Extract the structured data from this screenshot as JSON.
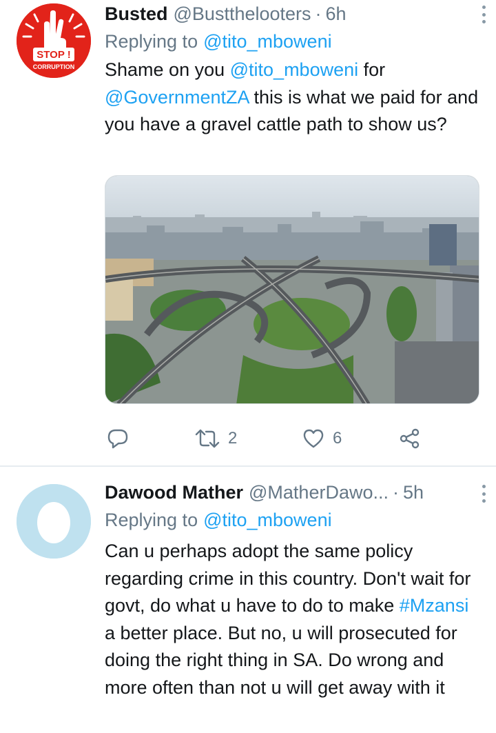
{
  "tweets": [
    {
      "name": "Busted",
      "handle": "@Bustthelooters",
      "dot": "·",
      "time": "6h",
      "replying_label": "Replying to",
      "replying_to": "@tito_mboweni",
      "text_parts": {
        "p1": "Shame on you ",
        "m1": "@tito_mboweni",
        "p2": " for ",
        "m2": "@GovernmentZA",
        "p3": " this is what we paid for and you have a gravel cattle path to show us?"
      },
      "avatar": {
        "label_top": "STOP !",
        "label_bottom": "CORRUPTION",
        "color": "#e2231a"
      },
      "media": {
        "description": "aerial city highway interchange"
      },
      "actions": {
        "reply_count": "",
        "retweet_count": "2",
        "like_count": "6"
      }
    },
    {
      "name": "Dawood Mather",
      "handle": "@MatherDawo...",
      "dot": "·",
      "time": "5h",
      "replying_label": "Replying to",
      "replying_to": "@tito_mboweni",
      "text_parts": {
        "p1": "Can u perhaps adopt the same policy regarding crime in this country. Don't wait for govt, do what u have to do to make ",
        "m1": "#Mzansi",
        "p2": " a better place. But no, u will prosecuted for doing the right thing in SA. Do wrong and more often than not u will get away with it"
      },
      "avatar": {
        "color": "#bfe1ef"
      }
    }
  ],
  "colors": {
    "link": "#1da1f2",
    "secondary": "#657786",
    "divider": "#e6ecf0"
  },
  "icons": [
    "reply-icon",
    "retweet-icon",
    "like-icon",
    "share-icon",
    "more-icon"
  ]
}
